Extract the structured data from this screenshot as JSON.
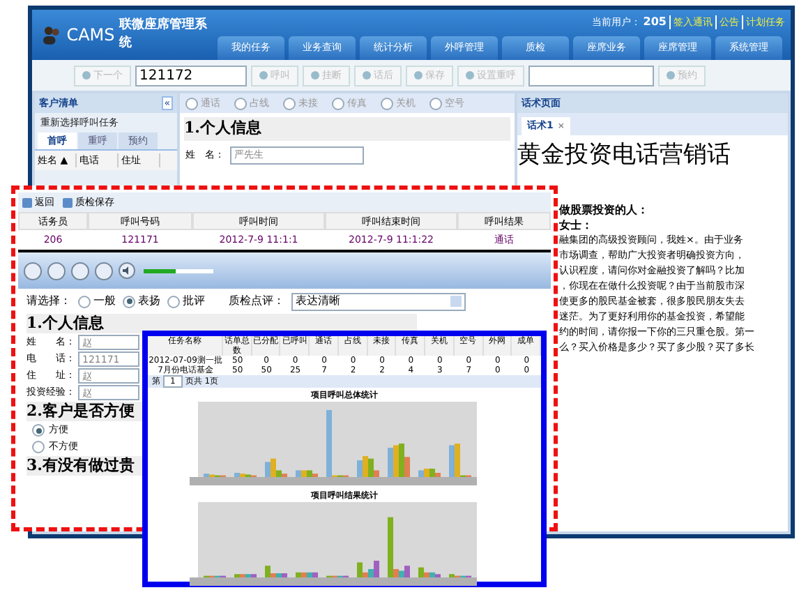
{
  "app": {
    "brand": "CAMS",
    "title": "联微座席管理系统",
    "user_label": "当前用户：",
    "user": "205",
    "links": [
      "签入通讯",
      "公告",
      "计划任务"
    ]
  },
  "nav_tabs": [
    {
      "label": "我的任务",
      "selected": false
    },
    {
      "label": "业务查询",
      "selected": false
    },
    {
      "label": "统计分析",
      "selected": false
    },
    {
      "label": "外呼管理",
      "selected": false
    },
    {
      "label": "质检",
      "selected": false
    },
    {
      "label": "座席业务",
      "selected": false
    },
    {
      "label": "座席管理",
      "selected": false
    },
    {
      "label": "系统管理",
      "selected": false
    }
  ],
  "toolbar": [
    {
      "kind": "button",
      "label": "下一个",
      "disabled": true
    },
    {
      "kind": "input",
      "value": "121172"
    },
    {
      "kind": "button",
      "label": "呼叫",
      "disabled": true
    },
    {
      "kind": "button",
      "label": "挂断",
      "disabled": true
    },
    {
      "kind": "button",
      "label": "话后",
      "disabled": true
    },
    {
      "kind": "button",
      "label": "保存",
      "disabled": true
    },
    {
      "kind": "button",
      "label": "设置重呼",
      "disabled": true
    },
    {
      "kind": "input"
    },
    {
      "kind": "button",
      "label": "预约",
      "disabled": true
    }
  ],
  "customer_list": {
    "title": "客户清单",
    "collapse": "«",
    "action": "重新选择呼叫任务",
    "tabs": [
      {
        "label": "首呼",
        "selected": true
      },
      {
        "label": "重呼",
        "selected": false
      },
      {
        "label": "预约",
        "selected": false
      }
    ],
    "columns": [
      "姓名 ▲",
      "电话",
      "住址"
    ]
  },
  "call_result": {
    "options": [
      {
        "label": "通话",
        "selected": false
      },
      {
        "label": "占线",
        "selected": false
      },
      {
        "label": "未接",
        "selected": false
      },
      {
        "label": "传真",
        "selected": false
      },
      {
        "label": "关机",
        "selected": false
      },
      {
        "label": "空号",
        "selected": false
      }
    ],
    "section": "1.个人信息",
    "field_label": "姓　名：",
    "field_placeholder": "严先生"
  },
  "script_page": {
    "title": "话术页面",
    "tab": "话术1",
    "tab_close": "×",
    "heading": "黄金投资电话营销话",
    "lines": [
      "做股票投资的人：",
      "女士："
    ],
    "body": [
      "融集团的高级投资顾问，我姓×。由于业务",
      "市场调查，帮助广大投资者明确投资方向，",
      "认识程度，请问你对金融投资了解吗？比加",
      "，你现在在做什么投资呢？由于当前股市深",
      "使更多的股民基金被套，很多股民朋友失去",
      "迷茫。为了更好利用你的基金投资，希望能",
      "约的时间，请你报一下你的三只重仓股。第一",
      "么？买入价格是多少？买了多少股？买了多长"
    ]
  },
  "qc_panel": {
    "actions": [
      "返回",
      "质检保存"
    ],
    "columns": [
      "话务员",
      "呼叫号码",
      "呼叫时间",
      "呼叫结束时间",
      "呼叫结果"
    ],
    "row": [
      "206",
      "121171",
      "2012-7-9 11:1:1",
      "2012-7-9 11:1:22",
      "通话"
    ],
    "player": {
      "level": 0.45
    },
    "choose_label": "请选择：",
    "ratings": [
      {
        "label": "一般",
        "selected": false
      },
      {
        "label": "表扬",
        "selected": true
      },
      {
        "label": "批评",
        "selected": false
      }
    ],
    "comment_label": "质检点评：",
    "comment": "表达清晰",
    "form": [
      {
        "kind": "heading",
        "text": "1.个人信息"
      },
      {
        "kind": "field",
        "label": "姓　　名：",
        "placeholder": "赵"
      },
      {
        "kind": "field",
        "label": "电　　话：",
        "placeholder": "121171"
      },
      {
        "kind": "field",
        "label": "住　　址：",
        "placeholder": "赵"
      },
      {
        "kind": "field",
        "label": "投资经验：",
        "placeholder": "赵"
      },
      {
        "kind": "heading",
        "text": "2.客户是否方便"
      },
      {
        "kind": "radio",
        "label": "方便",
        "selected": true
      },
      {
        "kind": "radio",
        "label": "不方便",
        "selected": false
      },
      {
        "kind": "heading",
        "text": "3.有没有做过贵"
      }
    ]
  },
  "stats_panel": {
    "columns": [
      "任务名称",
      "话单总数",
      "已分配",
      "已呼叫",
      "通话",
      "占线",
      "未接",
      "传真",
      "关机",
      "空号",
      "外网",
      "成单"
    ],
    "rows": [
      [
        "2012-07-09测一批",
        "50",
        "0",
        "0",
        "0",
        "0",
        "0",
        "0",
        "0",
        "0",
        "0",
        "0"
      ],
      [
        "7月份电话基金",
        "50",
        "50",
        "25",
        "7",
        "2",
        "2",
        "4",
        "3",
        "7",
        "0",
        "0"
      ]
    ],
    "pager": {
      "before": "第",
      "page": "1",
      "after": "页共 1页"
    },
    "charts": [
      "项目呼叫总体统计",
      "项目呼叫结果统计"
    ]
  }
}
